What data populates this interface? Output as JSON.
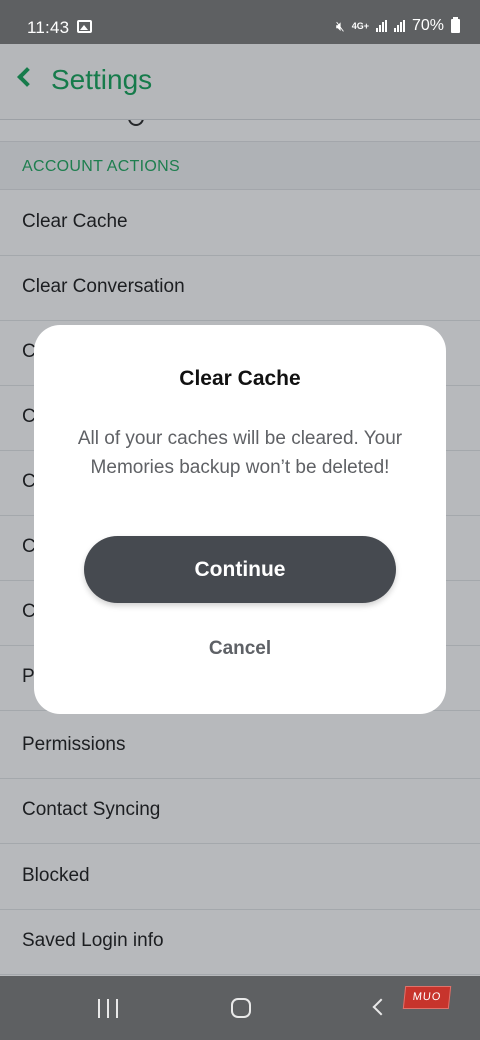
{
  "status_bar": {
    "time": "11:43",
    "network_type": "4G+",
    "battery": "70%"
  },
  "header": {
    "title": "Settings"
  },
  "section": {
    "label": "ACCOUNT ACTIONS"
  },
  "menu_items": [
    "Clear Cache",
    "Clear Conversation",
    "C",
    "C",
    "C",
    "C",
    "C",
    "P",
    "Permissions",
    "Contact Syncing",
    "Blocked",
    "Saved Login info"
  ],
  "dialog": {
    "title": "Clear Cache",
    "message": "All of your caches will be cleared. Your Memories backup won’t be deleted!",
    "continue_label": "Continue",
    "cancel_label": "Cancel"
  },
  "watermark": "MUO",
  "icons": {
    "back": "chevron-left-icon",
    "gallery": "image-icon",
    "mute": "mute-icon",
    "signal": "signal-icon",
    "battery": "battery-icon",
    "recents": "recents-icon",
    "home": "home-icon",
    "nav_back": "nav-back-icon"
  },
  "colors": {
    "accent": "#12a459",
    "dialog_button": "#464a50",
    "status_bar": "#5e6062"
  }
}
